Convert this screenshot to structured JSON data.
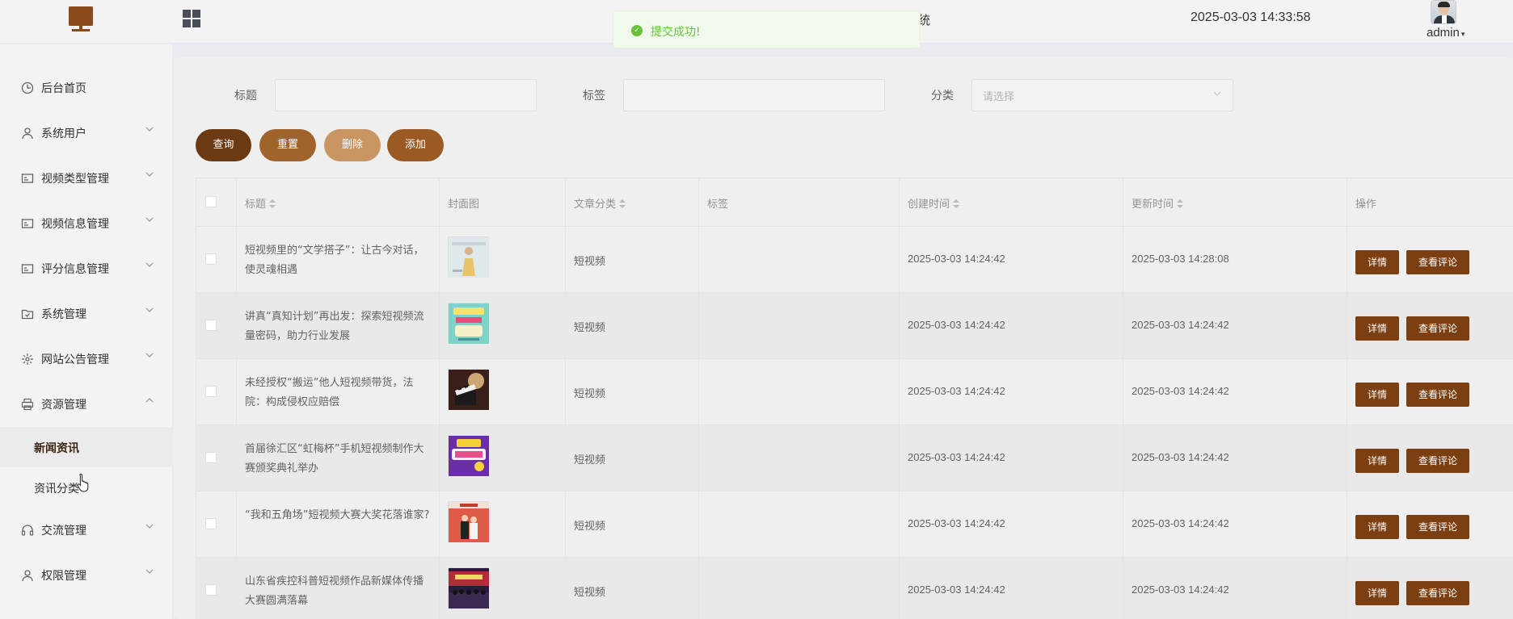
{
  "header": {
    "app_title_tail": "统",
    "datetime": "2025-03-03 14:33:58",
    "username": "admin",
    "caret": "▾"
  },
  "toast": {
    "message": "提交成功!",
    "icon": "check-circle-icon",
    "color": "#67c23a"
  },
  "sidebar": {
    "items": [
      {
        "label": "后台首页",
        "icon": "clock-icon",
        "has_arrow": false
      },
      {
        "label": "系统用户",
        "icon": "user-icon",
        "has_arrow": true
      },
      {
        "label": "视频类型管理",
        "icon": "card-icon",
        "has_arrow": true
      },
      {
        "label": "视频信息管理",
        "icon": "card-icon",
        "has_arrow": true
      },
      {
        "label": "评分信息管理",
        "icon": "card-icon",
        "has_arrow": true
      },
      {
        "label": "系统管理",
        "icon": "folder-check-icon",
        "has_arrow": true
      },
      {
        "label": "网站公告管理",
        "icon": "sun-icon",
        "has_arrow": true
      },
      {
        "label": "资源管理",
        "icon": "printer-icon",
        "has_arrow": true,
        "expanded": true
      },
      {
        "label": "交流管理",
        "icon": "headset-icon",
        "has_arrow": true
      },
      {
        "label": "权限管理",
        "icon": "user-icon",
        "has_arrow": true
      }
    ],
    "subitems": [
      {
        "label": "新闻资讯",
        "active": true
      },
      {
        "label": "资讯分类",
        "active": false
      }
    ]
  },
  "search": {
    "title_label": "标题",
    "title_value": "",
    "tag_label": "标签",
    "tag_value": "",
    "category_label": "分类",
    "category_placeholder": "请选择"
  },
  "buttons": {
    "query": "查询",
    "reset": "重置",
    "delete": "删除",
    "add": "添加"
  },
  "colors": {
    "query": "#6b3a12",
    "reset": "#a0632b",
    "delete": "#c99563",
    "add": "#9b5a22",
    "op_button": "#7b3f12"
  },
  "table": {
    "headers": {
      "title": "标题",
      "cover": "封面图",
      "category": "文章分类",
      "tag": "标签",
      "created": "创建时间",
      "updated": "更新时间",
      "action": "操作"
    },
    "detail_label": "详情",
    "comment_label": "查看评论",
    "rows": [
      {
        "title": "短视频里的“文学搭子”：让古今对话，使灵魂相遇",
        "category": "短视频",
        "tag": "",
        "created": "2025-03-03 14:24:42",
        "updated": "2025-03-03 14:28:08",
        "thumb": "thumb-woman-poster"
      },
      {
        "title": "讲真“真知计划”再出发：探索短视频流量密码，助力行业发展",
        "category": "短视频",
        "tag": "",
        "created": "2025-03-03 14:24:42",
        "updated": "2025-03-03 14:24:42",
        "thumb": "thumb-green-poster"
      },
      {
        "title": "未经授权“搬运”他人短视频带货，法院：构成侵权应赔偿",
        "category": "短视频",
        "tag": "",
        "created": "2025-03-03 14:24:42",
        "updated": "2025-03-03 14:24:42",
        "thumb": "thumb-film-clapper"
      },
      {
        "title": "首届徐汇区“虹梅杯”手机短视频制作大赛颁奖典礼举办",
        "category": "短视频",
        "tag": "",
        "created": "2025-03-03 14:24:42",
        "updated": "2025-03-03 14:24:42",
        "thumb": "thumb-purple-poster"
      },
      {
        "title": "“我和五角场”短视频大赛大奖花落谁家?",
        "category": "短视频",
        "tag": "",
        "created": "2025-03-03 14:24:42",
        "updated": "2025-03-03 14:24:42",
        "thumb": "thumb-award-red"
      },
      {
        "title": "山东省疾控科普短视频作品新媒体传播大赛圆满落幕",
        "category": "短视频",
        "tag": "",
        "created": "2025-03-03 14:24:42",
        "updated": "2025-03-03 14:24:42",
        "thumb": "thumb-stage-crowd"
      }
    ]
  }
}
